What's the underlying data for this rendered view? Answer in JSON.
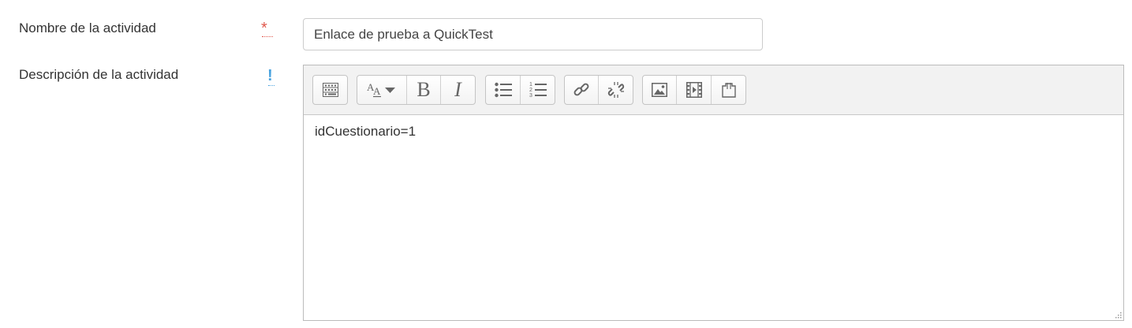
{
  "form": {
    "name_label": "Nombre de la actividad",
    "name_required_icon": "asterisk-required-icon",
    "name_required_mark": "*",
    "name_value": "Enlace de prueba a QuickTest",
    "description_label": "Descripción de la actividad",
    "description_help_icon": "help-exclamation-icon",
    "description_help_mark": "!"
  },
  "editor": {
    "content": "idCuestionario=1",
    "toolbar": {
      "groups": [
        [
          "toolbar-toggle-icon"
        ],
        [
          "font-style-dropdown-icon",
          "bold-icon",
          "italic-icon"
        ],
        [
          "unordered-list-icon",
          "ordered-list-icon"
        ],
        [
          "link-icon",
          "unlink-icon"
        ],
        [
          "image-icon",
          "media-icon",
          "file-manager-icon"
        ]
      ],
      "bold_glyph": "B",
      "italic_glyph": "I"
    }
  },
  "colors": {
    "required": "#e0584d",
    "help": "#4aa3df",
    "toolbar_bg": "#f2f2f2"
  }
}
